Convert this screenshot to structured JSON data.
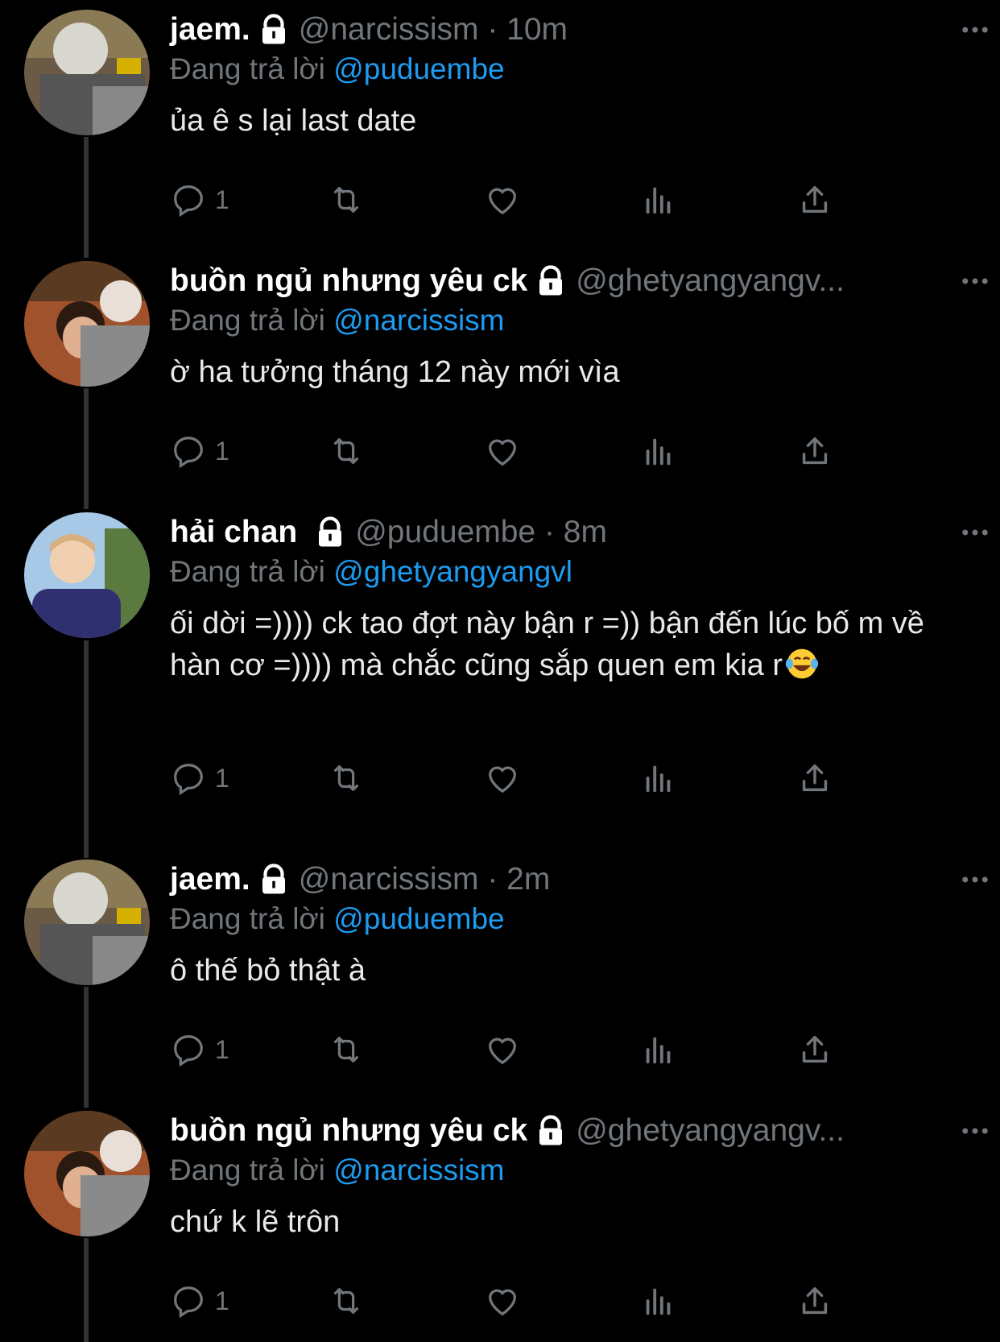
{
  "colors": {
    "background": "#000000",
    "text": "#e7e9ea",
    "muted": "#71767b",
    "link": "#1d9bf0",
    "thread_line": "#2f3336"
  },
  "reply_prefix": "Đang trả lời",
  "tweets": [
    {
      "name": "jaem.",
      "handle": "@narcissism · 10m",
      "reply_to": "@puduembe",
      "text": "ủa ê s lại last date",
      "reply_count": "1",
      "avatar": "avatar-jaem"
    },
    {
      "name": "buồn ngủ nhưng yêu ck",
      "handle": "@ghetyangyangv...",
      "reply_to": "@narcissism",
      "text": "ờ ha tưởng tháng 12 này mới vìa",
      "reply_count": "1",
      "avatar": "avatar-buon"
    },
    {
      "name": "hải chan",
      "handle": "@puduembe · 8m",
      "reply_to": "@ghetyangyangvl",
      "text": "ối dời =)))) ck tao đợt này bận r =)) bận đến lúc bố m về hàn cơ =)))) mà chắc cũng sắp quen em kia r",
      "text_emoji": "face-with-tears-of-joy-emoji",
      "reply_count": "1",
      "avatar": "avatar-hai"
    },
    {
      "name": "jaem.",
      "handle": "@narcissism · 2m",
      "reply_to": "@puduembe",
      "text": "ô thế bỏ thật à",
      "reply_count": "1",
      "avatar": "avatar-jaem"
    },
    {
      "name": "buồn ngủ nhưng yêu ck",
      "handle": "@ghetyangyangv...",
      "reply_to": "@narcissism",
      "text": "chứ k lẽ trôn",
      "reply_count": "1",
      "avatar": "avatar-buon"
    }
  ]
}
